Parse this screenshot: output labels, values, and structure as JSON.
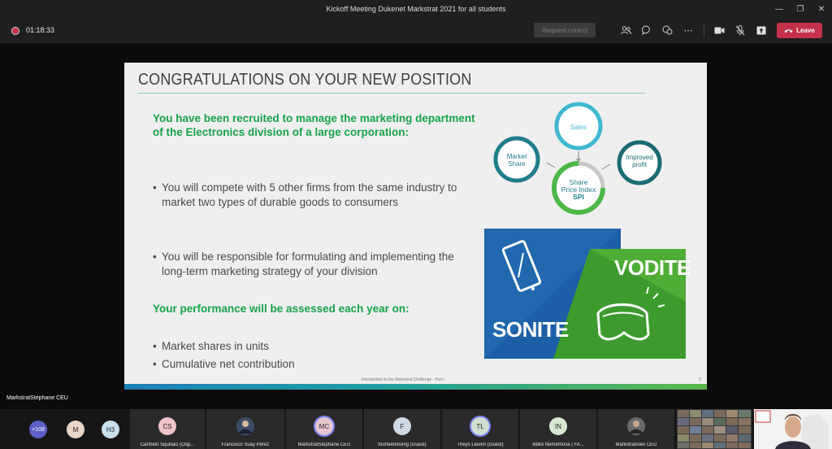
{
  "window": {
    "title": "Kickoff Meeting Dukenet Markstrat 2021 for all students"
  },
  "toolbar": {
    "timer": "01:18:33",
    "request_control": "Request control",
    "leave_label": "Leave"
  },
  "slide": {
    "title": "CONGRATULATIONS ON YOUR NEW POSITION",
    "intro_heading": "You have been recruited to manage the marketing department of the Electronics division of a large corporation:",
    "bullets_top": [
      "You will compete with 5 other firms from the same industry to market two types of durable goods to consumers",
      "You will be responsible for formulating and implementing the long-term marketing strategy of your division"
    ],
    "perf_heading": "Your performance will be assessed each year on:",
    "bullets_bottom": [
      "Market shares in units",
      "Cumulative net contribution"
    ],
    "diagram": {
      "sales": "Sales",
      "market_share": "Market Share",
      "improved_profit": "Improved profit",
      "center_line1": "Share",
      "center_line2": "Price Index",
      "center_line3": "SPI"
    },
    "brands": {
      "sonite": "SONITE",
      "vodite": "VODITE"
    },
    "footer": "Introduction to the Markstrat Challenge - Part I",
    "page_number": "2",
    "colors": {
      "green": "#17a34a",
      "teal": "#1f7d8c",
      "blue": "#1d5fa6"
    }
  },
  "presenter_label": "MarkstratStephane CEU",
  "participants": {
    "overflow": "+108",
    "small": [
      {
        "initials": "M",
        "color": "#e8d6c8"
      },
      {
        "initials": "H3",
        "color": "#c9e0ec"
      }
    ],
    "tiles": [
      {
        "initials": "CS",
        "name": "Carmelo Squillaci (Osp...",
        "color": "#f0c3c9",
        "video": false
      },
      {
        "initials": "",
        "name": "Francisco Suay Pérez",
        "color": "#5a6a80",
        "video": true
      },
      {
        "initials": "MC",
        "name": "MarkstratStephane CEU",
        "color": "#e8c6cf",
        "video": false,
        "speaking": true
      },
      {
        "initials": "F",
        "name": "fourteenloving (Guest)",
        "color": "#cfd9e6",
        "video": false
      },
      {
        "initials": "TL",
        "name": "Theys Lieven (Guest)",
        "color": "#cfe2d2",
        "video": false,
        "speaking": true
      },
      {
        "initials": "IN",
        "name": "Ildikó Némethová | FA...",
        "color": "#d6e8d2",
        "video": false
      },
      {
        "initials": "",
        "name": "MarkstratAlex CEU",
        "color": "#4a4a4a",
        "video": true
      }
    ]
  }
}
